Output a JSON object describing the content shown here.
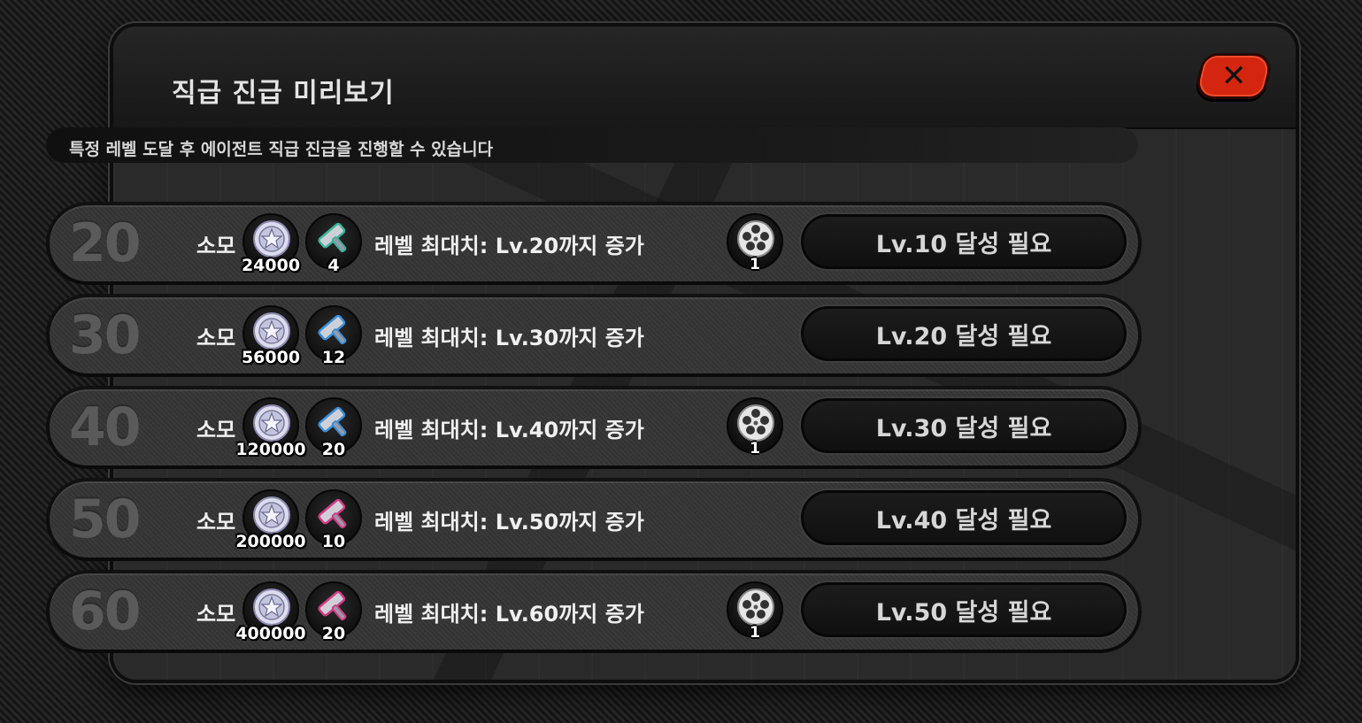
{
  "title": "직급 진급 미리보기",
  "info": "특정 레벨 도달 후 에이전트 직급 진급을 진행할 수 있습니다",
  "colors": {
    "accent_close": "#d4260e",
    "panel": "#1e1e1e",
    "text": "#f0f0f0"
  },
  "icons": {
    "close": "close-icon",
    "coin": "denny-coin-icon",
    "hammer": "promotion-material-icon",
    "film": "film-reel-icon"
  },
  "rows": [
    {
      "level": "20",
      "consume_label": "소모",
      "coin_count": "24000",
      "material_count": "4",
      "material_color": "#3bb39a",
      "effect": "레벨 최대치: Lv.20까지 증가",
      "has_reward": true,
      "reward_count": "1",
      "requirement": "Lv.10 달성 필요"
    },
    {
      "level": "30",
      "consume_label": "소모",
      "coin_count": "56000",
      "material_count": "12",
      "material_color": "#3a90d8",
      "effect": "레벨 최대치: Lv.30까지 증가",
      "has_reward": false,
      "requirement": "Lv.20 달성 필요"
    },
    {
      "level": "40",
      "consume_label": "소모",
      "coin_count": "120000",
      "material_count": "20",
      "material_color": "#3a90d8",
      "effect": "레벨 최대치: Lv.40까지 증가",
      "has_reward": true,
      "reward_count": "1",
      "requirement": "Lv.30 달성 필요"
    },
    {
      "level": "50",
      "consume_label": "소모",
      "coin_count": "200000",
      "material_count": "10",
      "material_color": "#d23c86",
      "effect": "레벨 최대치: Lv.50까지 증가",
      "has_reward": false,
      "requirement": "Lv.40 달성 필요"
    },
    {
      "level": "60",
      "consume_label": "소모",
      "coin_count": "400000",
      "material_count": "20",
      "material_color": "#d23c86",
      "effect": "레벨 최대치: Lv.60까지 증가",
      "has_reward": true,
      "reward_count": "1",
      "requirement": "Lv.50 달성 필요"
    }
  ]
}
